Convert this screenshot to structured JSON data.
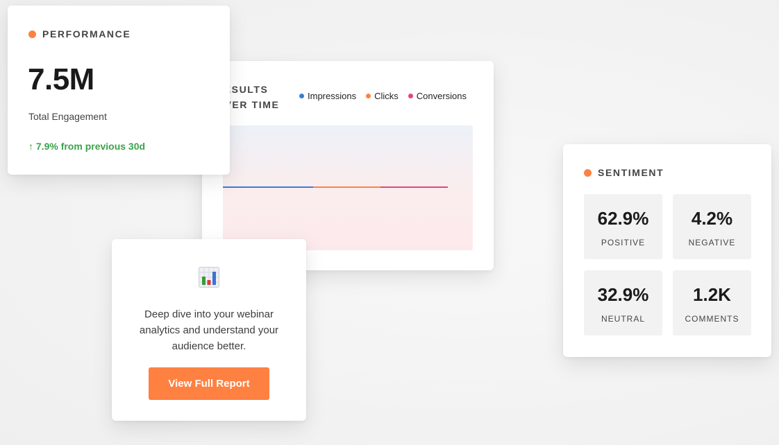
{
  "performance": {
    "title": "PERFORMANCE",
    "value": "7.5M",
    "label": "Total Engagement",
    "change": "↑ 7.9% from previous 30d"
  },
  "results": {
    "title": "RESULTS OVER TIME",
    "legend": [
      {
        "name": "Impressions",
        "color": "#3c7bd6"
      },
      {
        "name": "Clicks",
        "color": "#ff8142"
      },
      {
        "name": "Conversions",
        "color": "#e2467a"
      }
    ]
  },
  "report": {
    "icon": "bar-chart-icon",
    "text": "Deep dive into your webinar analytics and understand your audience better.",
    "button_label": "View Full Report"
  },
  "sentiment": {
    "title": "SENTIMENT",
    "tiles": [
      {
        "value": "62.9%",
        "label": "POSITIVE"
      },
      {
        "value": "4.2%",
        "label": "NEGATIVE"
      },
      {
        "value": "32.9%",
        "label": "NEUTRAL"
      },
      {
        "value": "1.2K",
        "label": "COMMENTS"
      }
    ]
  },
  "colors": {
    "accent": "#ff8142",
    "positive_change": "#3aa24a"
  }
}
